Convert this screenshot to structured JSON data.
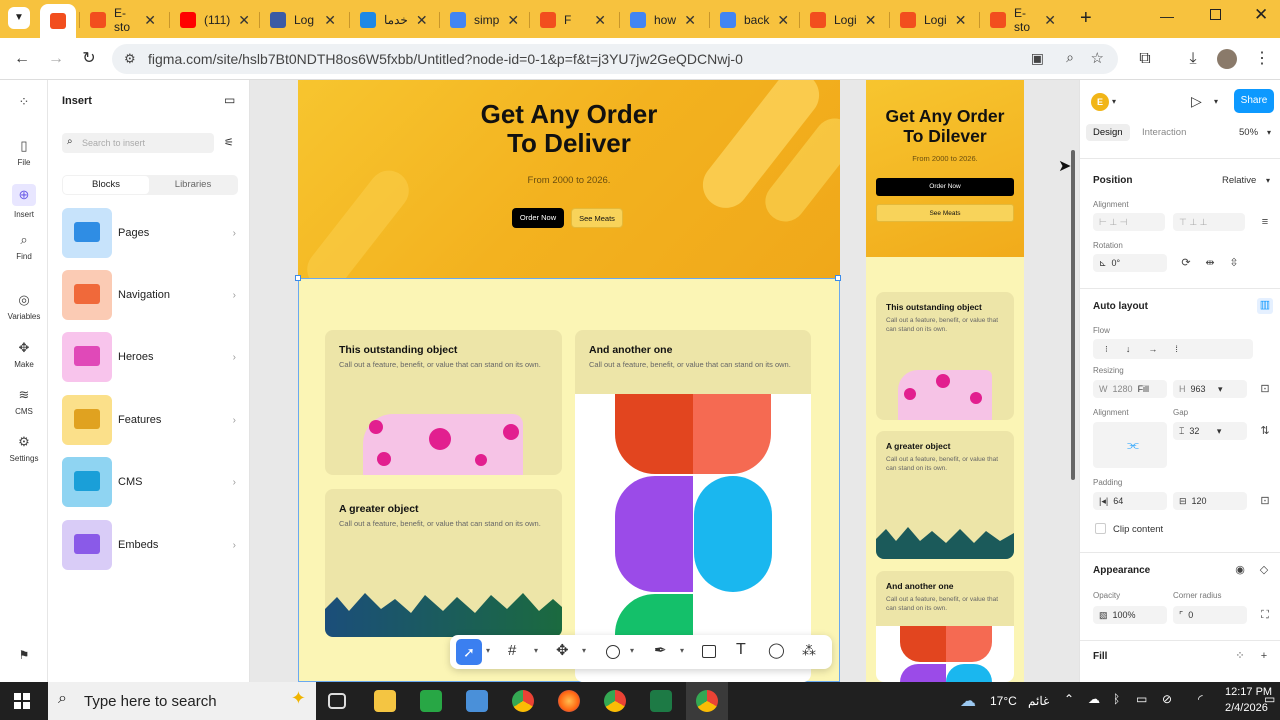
{
  "browser": {
    "tabs": [
      {
        "label": "",
        "icon": "figma-icon",
        "color": "#f24e1e",
        "active": true
      },
      {
        "label": "E-sto",
        "icon": "figma-icon",
        "color": "#f24e1e"
      },
      {
        "label": "(111)",
        "icon": "youtube-icon",
        "color": "#ff0000"
      },
      {
        "label": "Log",
        "icon": "bookmark-icon",
        "color": "#3b5ba5"
      },
      {
        "label": "خدما",
        "icon": "cube-icon",
        "color": "#1e88e5"
      },
      {
        "label": "simp",
        "icon": "google-icon",
        "color": "#4285f4"
      },
      {
        "label": "F",
        "icon": "figma-icon",
        "color": "#f24e1e"
      },
      {
        "label": "how",
        "icon": "google-icon",
        "color": "#4285f4"
      },
      {
        "label": "back",
        "icon": "google-icon",
        "color": "#4285f4"
      },
      {
        "label": "Logi",
        "icon": "figma-icon",
        "color": "#f24e1e"
      },
      {
        "label": "Logi",
        "icon": "figma-icon",
        "color": "#f24e1e"
      },
      {
        "label": "E-sto",
        "icon": "figma-icon",
        "color": "#f24e1e"
      }
    ],
    "new_tab_label": "+",
    "url": "figma.com/site/hslb7Bt0NDTH8os6W5fxbb/Untitled?node-id=0-1&p=f&t=j3YU7jw2GeQDCNwj-0"
  },
  "rail": {
    "items": [
      {
        "label": "",
        "icon": "figma-logo-icon"
      },
      {
        "label": "File",
        "icon": "file-icon"
      },
      {
        "label": "Insert",
        "icon": "insert-icon"
      },
      {
        "label": "Find",
        "icon": "search-icon"
      },
      {
        "label": "Variables",
        "icon": "variables-icon"
      },
      {
        "label": "Make",
        "icon": "make-icon"
      },
      {
        "label": "CMS",
        "icon": "database-icon"
      },
      {
        "label": "Settings",
        "icon": "gear-icon"
      }
    ]
  },
  "insert_panel": {
    "title": "Insert",
    "search_placeholder": "Search to insert",
    "tabs": [
      "Blocks",
      "Libraries"
    ],
    "blocks": [
      {
        "label": "Pages",
        "color": "#c7e3fb",
        "accent": "#2f8de4"
      },
      {
        "label": "Navigation",
        "color": "#fbcbb4",
        "accent": "#f0693a"
      },
      {
        "label": "Heroes",
        "color": "#f8c4ec",
        "accent": "#e049b8"
      },
      {
        "label": "Features",
        "color": "#fbe08a",
        "accent": "#e0a220"
      },
      {
        "label": "CMS",
        "color": "#8fd4f2",
        "accent": "#1a9fd8"
      },
      {
        "label": "Embeds",
        "color": "#d9ccf7",
        "accent": "#8a5ae8"
      }
    ]
  },
  "canvas": {
    "hero_title_line1": "Get Any Order",
    "hero_title_line2": "To Deliver",
    "hero_subtitle": "From 2000 to 2026.",
    "btn_order": "Order Now",
    "btn_see": "See Meats",
    "cards": [
      {
        "title": "This outstanding object",
        "desc": "Call out a feature, benefit, or value that can stand on its own."
      },
      {
        "title": "And another one",
        "desc": "Call out a feature, benefit, or value that can stand on its own."
      },
      {
        "title": "A greater object",
        "desc": "Call out a feature, benefit, or value that can stand on its own."
      }
    ],
    "mobile_title_line1": "Get Any Order",
    "mobile_title_line2": "To Dilever",
    "mobile_subtitle": "From 2000 to 2026.",
    "mobile_btn_order": "Order Now",
    "mobile_btn_see": "See Meats",
    "mobile_cards": [
      {
        "title": "This outstanding object",
        "desc": "Call out a feature, benefit, or value that can stand on its own."
      },
      {
        "title": "A greater object",
        "desc": "Call out a feature, benefit, or value that can stand on its own."
      },
      {
        "title": "And another one",
        "desc": "Call out a feature, benefit, or value that can stand on its own."
      }
    ]
  },
  "design_panel": {
    "avatar": "E",
    "share": "Share",
    "tab_design": "Design",
    "tab_interaction": "Interaction",
    "zoom": "50%",
    "position_title": "Position",
    "position_value": "Relative",
    "alignment_label": "Alignment",
    "rotation_label": "Rotation",
    "rotation_value": "0°",
    "autolayout_title": "Auto layout",
    "flow_label": "Flow",
    "resizing_label": "Resizing",
    "w_label": "W",
    "w_value": "1280",
    "w_mode": "Fill",
    "h_label": "H",
    "h_value": "963",
    "alignment2_label": "Alignment",
    "gap_label": "Gap",
    "gap_value": "32",
    "padding_label": "Padding",
    "padding_h": "64",
    "padding_v": "120",
    "clip_label": "Clip content",
    "appearance_title": "Appearance",
    "opacity_label": "Opacity",
    "opacity_value": "100%",
    "radius_label": "Corner radius",
    "radius_value": "0",
    "fill_title": "Fill"
  },
  "taskbar": {
    "search_placeholder": "Type here to search",
    "weather": "17°C",
    "weather_text": "غائم",
    "time": "12:17 PM",
    "date": "2/4/2026"
  }
}
